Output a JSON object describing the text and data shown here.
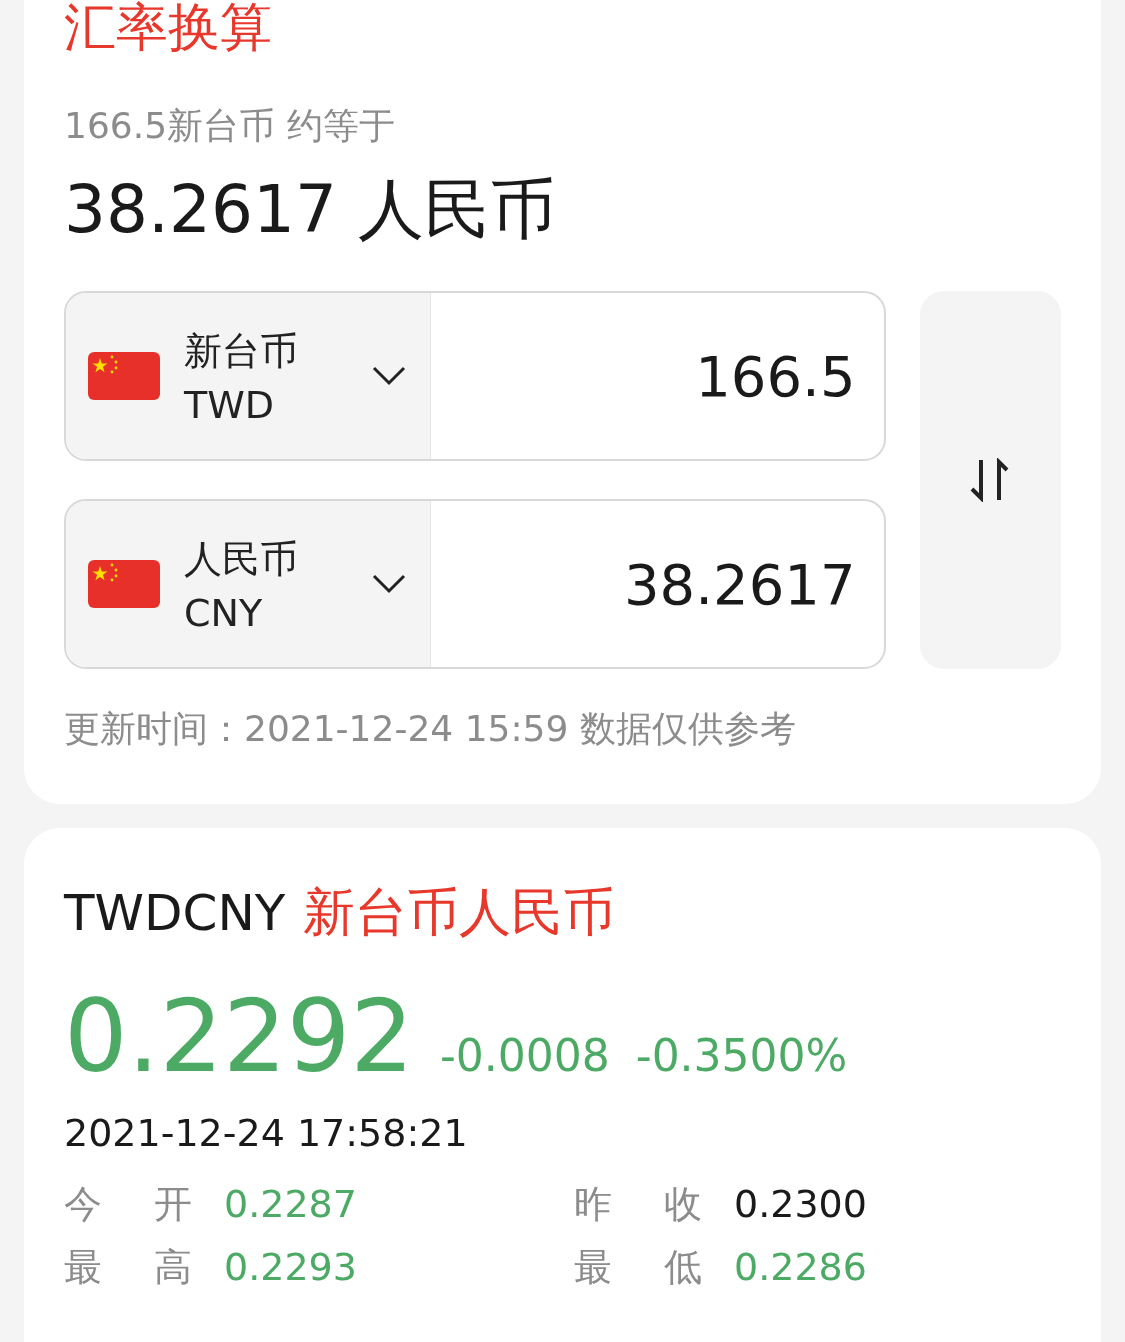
{
  "converter": {
    "title": "汇率换算",
    "subtitle": "166.5新台币 约等于",
    "result": "38.2617 人民币",
    "rows": [
      {
        "currency_name": "新台币",
        "currency_code": "TWD",
        "amount": "166.5"
      },
      {
        "currency_name": "人民币",
        "currency_code": "CNY",
        "amount": "38.2617"
      }
    ],
    "footnote": "更新时间：2021-12-24 15:59 数据仅供参考"
  },
  "quote": {
    "symbol": "TWDCNY",
    "pair_name": "新台币人民币",
    "rate": "0.2292",
    "change": "-0.0008",
    "change_percent": "-0.3500%",
    "color": "#4caa64",
    "timestamp": "2021-12-24 17:58:21",
    "stats": [
      {
        "label": "今 开",
        "value": "0.2287",
        "color": "#4caa64"
      },
      {
        "label": "昨 收",
        "value": "0.2300",
        "color": "#1a1a1a"
      },
      {
        "label": "最 高",
        "value": "0.2293",
        "color": "#4caa64"
      },
      {
        "label": "最 低",
        "value": "0.2286",
        "color": "#4caa64"
      }
    ]
  }
}
